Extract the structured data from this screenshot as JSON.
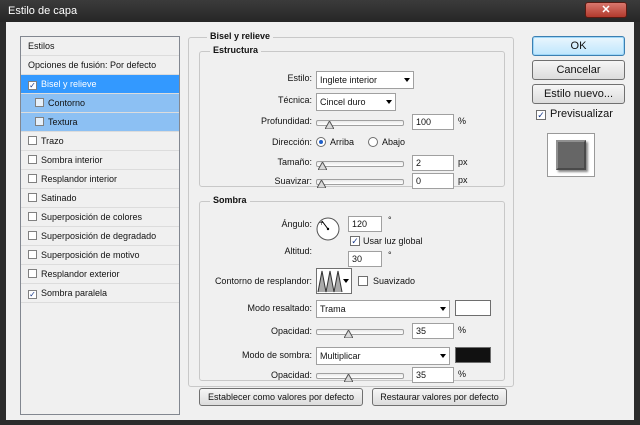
{
  "window": {
    "title": "Estilo de capa",
    "close_icon": "close-icon"
  },
  "left_panel": {
    "header": "Estilos",
    "blend_options": "Opciones de fusión: Por defecto",
    "items": [
      {
        "label": "Bisel y relieve",
        "checked": true,
        "selected": true
      },
      {
        "label": "Contorno",
        "checked": false,
        "sub": true
      },
      {
        "label": "Textura",
        "checked": false,
        "sub": true
      },
      {
        "label": "Trazo",
        "checked": false
      },
      {
        "label": "Sombra interior",
        "checked": false
      },
      {
        "label": "Resplandor interior",
        "checked": false
      },
      {
        "label": "Satinado",
        "checked": false
      },
      {
        "label": "Superposición de colores",
        "checked": false
      },
      {
        "label": "Superposición de degradado",
        "checked": false
      },
      {
        "label": "Superposición de motivo",
        "checked": false
      },
      {
        "label": "Resplandor exterior",
        "checked": false
      },
      {
        "label": "Sombra paralela",
        "checked": true
      }
    ]
  },
  "bevel": {
    "title": "Bisel y relieve",
    "structure": {
      "title": "Estructura",
      "style_label": "Estilo:",
      "style_value": "Inglete interior",
      "technique_label": "Técnica:",
      "technique_value": "Cincel duro",
      "depth_label": "Profundidad:",
      "depth_value": "100",
      "depth_unit": "%",
      "depth_level": 0.1,
      "direction_label": "Dirección:",
      "dir_up": "Arriba",
      "dir_down": "Abajo",
      "direction": "up",
      "size_label": "Tamaño:",
      "size_value": "2",
      "size_unit": "px",
      "size_level": 0.01,
      "soften_label": "Suavizar:",
      "soften_value": "0",
      "soften_unit": "px",
      "soften_level": 0.0
    },
    "shading": {
      "title": "Sombra",
      "angle_label": "Ángulo:",
      "angle_value": "120",
      "angle_unit": "°",
      "global_light_label": "Usar luz global",
      "global_light_checked": true,
      "altitude_label": "Altitud:",
      "altitude_value": "30",
      "altitude_unit": "°",
      "gloss_label": "Contorno de resplandor:",
      "antialias_label": "Suavizado",
      "antialias_checked": false,
      "highlight_mode_label": "Modo resaltado:",
      "highlight_mode_value": "Trama",
      "highlight_color": "#ffffff",
      "highlight_opacity_label": "Opacidad:",
      "highlight_opacity_value": "35",
      "highlight_opacity_unit": "%",
      "highlight_opacity_level": 0.35,
      "shadow_mode_label": "Modo de sombra:",
      "shadow_mode_value": "Multiplicar",
      "shadow_color": "#111111",
      "shadow_opacity_label": "Opacidad:",
      "shadow_opacity_value": "35",
      "shadow_opacity_unit": "%",
      "shadow_opacity_level": 0.35
    },
    "set_default_button": "Establecer como valores por defecto",
    "reset_default_button": "Restaurar valores por defecto"
  },
  "buttons": {
    "ok": "OK",
    "cancel": "Cancelar",
    "new_style": "Estilo nuevo...",
    "preview_label": "Previsualizar",
    "preview_checked": true
  }
}
